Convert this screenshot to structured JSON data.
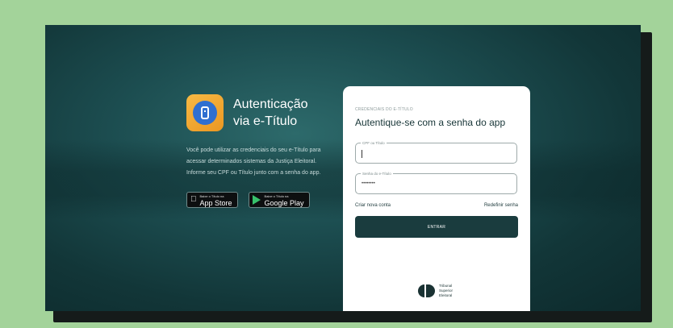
{
  "brand": {
    "title_line1": "Autenticação",
    "title_line2": "via e-Título",
    "icon": "phone-icon"
  },
  "description": {
    "line1": "Você pode utilizar as credenciais do seu e-Título para",
    "line2": "acessar determinados sistemas da Justiça Eleitoral.",
    "line3": "Informe seu CPF ou Título junto com a senha do app."
  },
  "stores": {
    "appstore_small": "Baixe o Título na",
    "appstore_big": "App Store",
    "googleplay_small": "Baixe o Título na",
    "googleplay_big": "Google Play"
  },
  "form": {
    "eyebrow": "CREDENCIAIS DO E-TÍTULO",
    "title": "Autentique-se com a senha do app",
    "cpf_label": "CPF ou Título",
    "cpf_value": "",
    "password_label": "Senha do e-Título",
    "password_value": "••••••••",
    "create_account": "Criar nova conta",
    "reset_password": "Redefinir senha",
    "submit": "ENTRAR"
  },
  "footer": {
    "org_line1": "Tribunal",
    "org_line2": "Superior",
    "org_line3": "Eleitoral"
  },
  "colors": {
    "page_bg": "#a3d39a",
    "screen_bg": "#1c4d50",
    "accent": "#1a3c3e",
    "app_icon": "#f0a52f"
  }
}
